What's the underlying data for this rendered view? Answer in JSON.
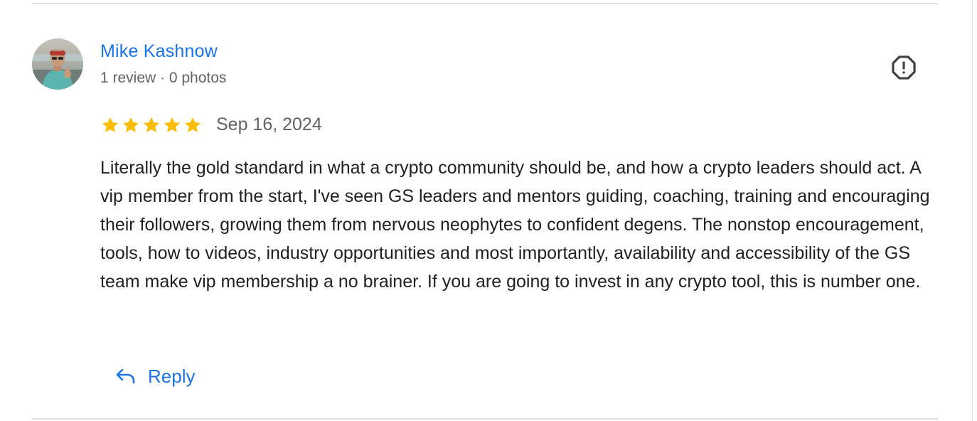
{
  "reviewer": {
    "name": "Mike Kashnow",
    "meta": "1 review · 0 photos"
  },
  "review": {
    "rating": 5,
    "max_rating": 5,
    "date": "Sep 16, 2024",
    "text": "Literally the gold standard in what a crypto community should be, and how a crypto leaders should act. A vip member from the start, I've seen GS leaders and mentors guiding, coaching, training and encouraging their followers, growing them from nervous neophytes to confident degens. The nonstop encouragement, tools, how to videos, industry opportunities and most importantly, availability and accessibility of the GS team make vip membership a no brainer. If you are going to invest in any crypto tool, this is number one."
  },
  "actions": {
    "reply_label": "Reply"
  },
  "icons": {
    "report": "report-octagon-icon",
    "reply": "reply-arrow-icon",
    "star": "star-icon"
  },
  "colors": {
    "link": "#1a73e8",
    "star": "#fbbc04",
    "text": "#202124",
    "muted": "#5f6368",
    "divider": "#dadce0"
  }
}
